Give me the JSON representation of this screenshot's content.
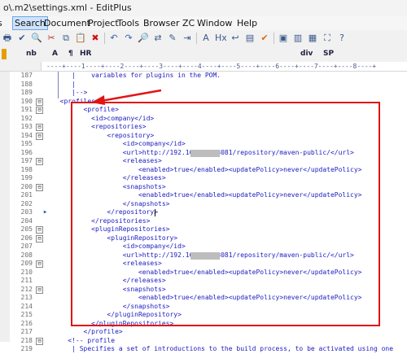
{
  "window": {
    "title": "o\\.m2\\settings.xml - EditPlus"
  },
  "menu": [
    "ls",
    "Search",
    "Document",
    "Project",
    "Tools",
    "Browser",
    "ZC",
    "Window",
    "Help"
  ],
  "menu_selected": "Search",
  "toolbar": {
    "icons": [
      "print-icon",
      "spellcheck-icon",
      "find-icon",
      "cut-icon",
      "copy-icon",
      "paste-icon",
      "delete-icon",
      "undo-icon",
      "redo-icon",
      "find-in-files-icon",
      "replace-icon",
      "spell-icon",
      "go-to-line-icon",
      "font-icon",
      "hex-icon",
      "word-wrap-icon",
      "column-select-icon",
      "check-icon",
      "window-layout-icon",
      "split-icon",
      "output-icon",
      "fullscreen-icon",
      "help-icon"
    ]
  },
  "html_toolbar": {
    "items": [
      "nb",
      "A",
      "¶",
      "HR",
      "div",
      "SP"
    ]
  },
  "ruler": {
    "text": "----+----1----+----2----+----3----+----4----+----5----+----6----+----7----+----8----+"
  },
  "lines": [
    {
      "n": "187",
      "text": "     |    variables for plugins in the POM."
    },
    {
      "n": "188",
      "text": "     |"
    },
    {
      "n": "189",
      "text": "     |-->"
    },
    {
      "n": "190",
      "text": "  <profiles>",
      "fold": "⊟"
    },
    {
      "n": "191",
      "text": "        <profile>",
      "fold": "⊟"
    },
    {
      "n": "192",
      "text": "          <id>company</id>"
    },
    {
      "n": "193",
      "text": "          <repositories>",
      "fold": "⊟"
    },
    {
      "n": "194",
      "text": "              <repository>",
      "fold": "⊟"
    },
    {
      "n": "195",
      "text": "                  <id>company</id>"
    },
    {
      "n": "196",
      "text": "                  <url>http://192.168.x.x:8081/repository/maven-public/</url>",
      "mask": true,
      "maskText": "http://192.16"
    },
    {
      "n": "197",
      "text": "                  <releases>",
      "fold": "⊟"
    },
    {
      "n": "198",
      "text": "                      <enabled>true</enabled><updatePolicy>never</updatePolicy>"
    },
    {
      "n": "199",
      "text": "                  </releases>"
    },
    {
      "n": "200",
      "text": "                  <snapshots>",
      "fold": "⊟"
    },
    {
      "n": "201",
      "text": "                      <enabled>true</enabled><updatePolicy>never</updatePolicy>"
    },
    {
      "n": "202",
      "text": "                  </snapshots>"
    },
    {
      "n": "203",
      "text": "              </repository>",
      "caret": true
    },
    {
      "n": "204",
      "text": "          </repositories>"
    },
    {
      "n": "205",
      "text": "          <pluginRepositories>",
      "fold": "⊟"
    },
    {
      "n": "206",
      "text": "              <pluginRepository>",
      "fold": "⊟"
    },
    {
      "n": "207",
      "text": "                  <id>company</id>"
    },
    {
      "n": "208",
      "text": "                  <url>http://192.168.x.x:8081/repository/maven-public/</url>",
      "mask": true
    },
    {
      "n": "209",
      "text": "                  <releases>",
      "fold": "⊟"
    },
    {
      "n": "210",
      "text": "                      <enabled>true</enabled><updatePolicy>never</updatePolicy>"
    },
    {
      "n": "211",
      "text": "                  </releases>"
    },
    {
      "n": "212",
      "text": "                  <snapshots>",
      "fold": "⊟"
    },
    {
      "n": "213",
      "text": "                      <enabled>true</enabled><updatePolicy>never</updatePolicy>"
    },
    {
      "n": "214",
      "text": "                  </snapshots>"
    },
    {
      "n": "215",
      "text": "              </pluginRepository>"
    },
    {
      "n": "216",
      "text": "          </pluginRepositories>"
    },
    {
      "n": "217",
      "text": "        </profile>"
    },
    {
      "n": "218",
      "text": "    <!-- profile",
      "fold": "⊟"
    },
    {
      "n": "219",
      "text": "     | Specifies a set of introductions to the build process, to be activated using one"
    }
  ],
  "colors": {
    "annotation": "#e11414",
    "code": "#1b1bc0",
    "linenumber": "#707070"
  }
}
